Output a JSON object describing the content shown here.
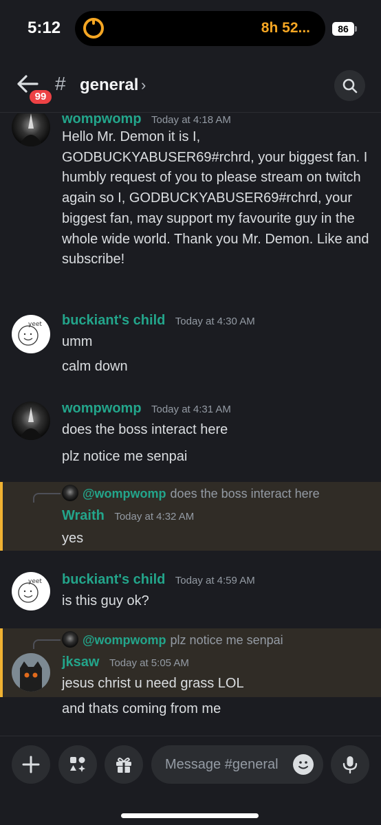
{
  "status_bar": {
    "time": "5:12",
    "live_activity": "8h 52...",
    "battery": "86"
  },
  "header": {
    "back_badge": "99",
    "hash": "#",
    "channel_name": "general",
    "chevron": "›"
  },
  "messages": [
    {
      "author": "wompwomp",
      "timestamp": "Today at 4:18 AM",
      "lines": [
        "Hello Mr. Demon it is I, GODBUCKYABUSER69#rchrd, your biggest fan. I humbly request of you to please stream on twitch again so I, GODBUCKYABUSER69#rchrd, your biggest fan, may support my favourite guy in the whole wide world. Thank you Mr. Demon. Like and subscribe!"
      ]
    },
    {
      "author": "buckiant's child",
      "timestamp": "Today at 4:30 AM",
      "lines": [
        "umm",
        "calm down"
      ]
    },
    {
      "author": "wompwomp",
      "timestamp": "Today at 4:31 AM",
      "lines": [
        "does the boss interact here",
        "plz notice me senpai"
      ]
    },
    {
      "reply_to": {
        "mention": "@wompwomp",
        "text": "does the boss interact here"
      },
      "author": "Wraith",
      "timestamp": "Today at 4:32 AM",
      "lines": [
        "yes"
      ]
    },
    {
      "author": "buckiant's child",
      "timestamp": "Today at 4:59 AM",
      "lines": [
        "is this guy ok?"
      ]
    },
    {
      "reply_to": {
        "mention": "@wompwomp",
        "text": "plz notice me senpai"
      },
      "author": "jksaw",
      "timestamp": "Today at 5:05 AM",
      "lines": [
        "jesus christ u need grass LOL",
        "and thats coming from me"
      ]
    }
  ],
  "avatar_text": {
    "yeet": "yeet"
  },
  "composer": {
    "placeholder": "Message #general"
  },
  "icons": {
    "back": "arrow-left-icon",
    "search": "search-icon",
    "plus": "plus-icon",
    "apps": "apps-icon",
    "gift": "gift-icon",
    "emoji": "emoji-icon",
    "mic": "microphone-icon"
  },
  "colors": {
    "background": "#1b1c21",
    "username": "#23a58b",
    "reply_highlight": "#302c26",
    "reply_bar": "#f0b232",
    "badge": "#ed4245",
    "live_activity": "#f5a623"
  }
}
